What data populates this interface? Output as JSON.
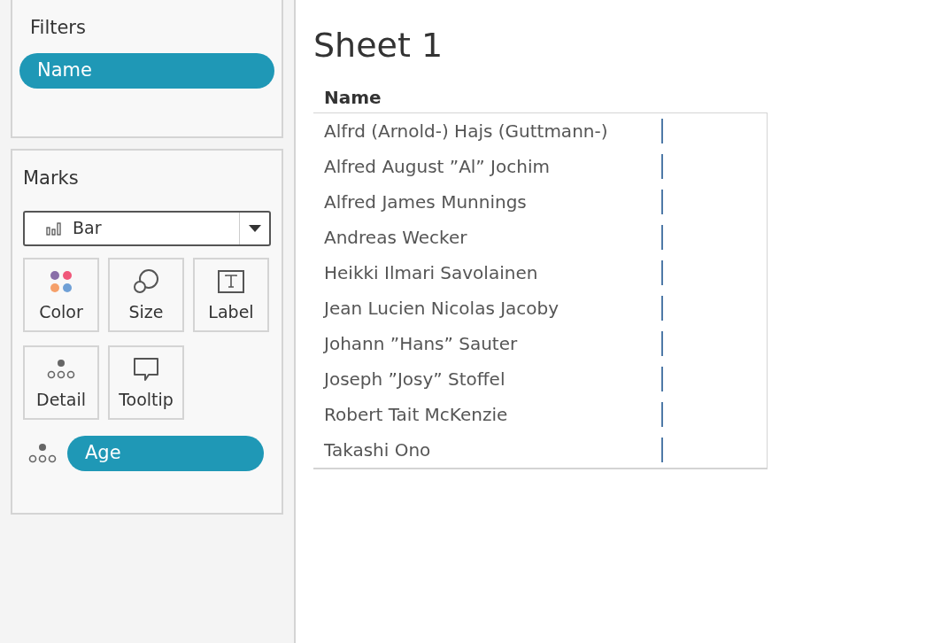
{
  "filters": {
    "title": "Filters",
    "pills": [
      "Name"
    ]
  },
  "marks": {
    "title": "Marks",
    "mark_type": "Bar",
    "cards": [
      {
        "kind": "color",
        "label": "Color"
      },
      {
        "kind": "size",
        "label": "Size"
      },
      {
        "kind": "label",
        "label": "Label"
      },
      {
        "kind": "detail",
        "label": "Detail"
      },
      {
        "kind": "tooltip",
        "label": "Tooltip"
      }
    ],
    "fields": [
      {
        "kind": "detail",
        "label": "Age"
      }
    ]
  },
  "sheet": {
    "title": "Sheet 1",
    "table": {
      "columns": [
        "Name"
      ],
      "rows": [
        "Alfrd (Arnold-) Hajs (Guttmann-)",
        "Alfred August ”Al” Jochim",
        "Alfred James Munnings",
        "Andreas Wecker",
        "Heikki Ilmari Savolainen",
        "Jean Lucien Nicolas Jacoby",
        "Johann ”Hans” Sauter",
        "Joseph ”Josy” Stoffel",
        "Robert Tait McKenzie",
        "Takashi Ono"
      ]
    }
  }
}
